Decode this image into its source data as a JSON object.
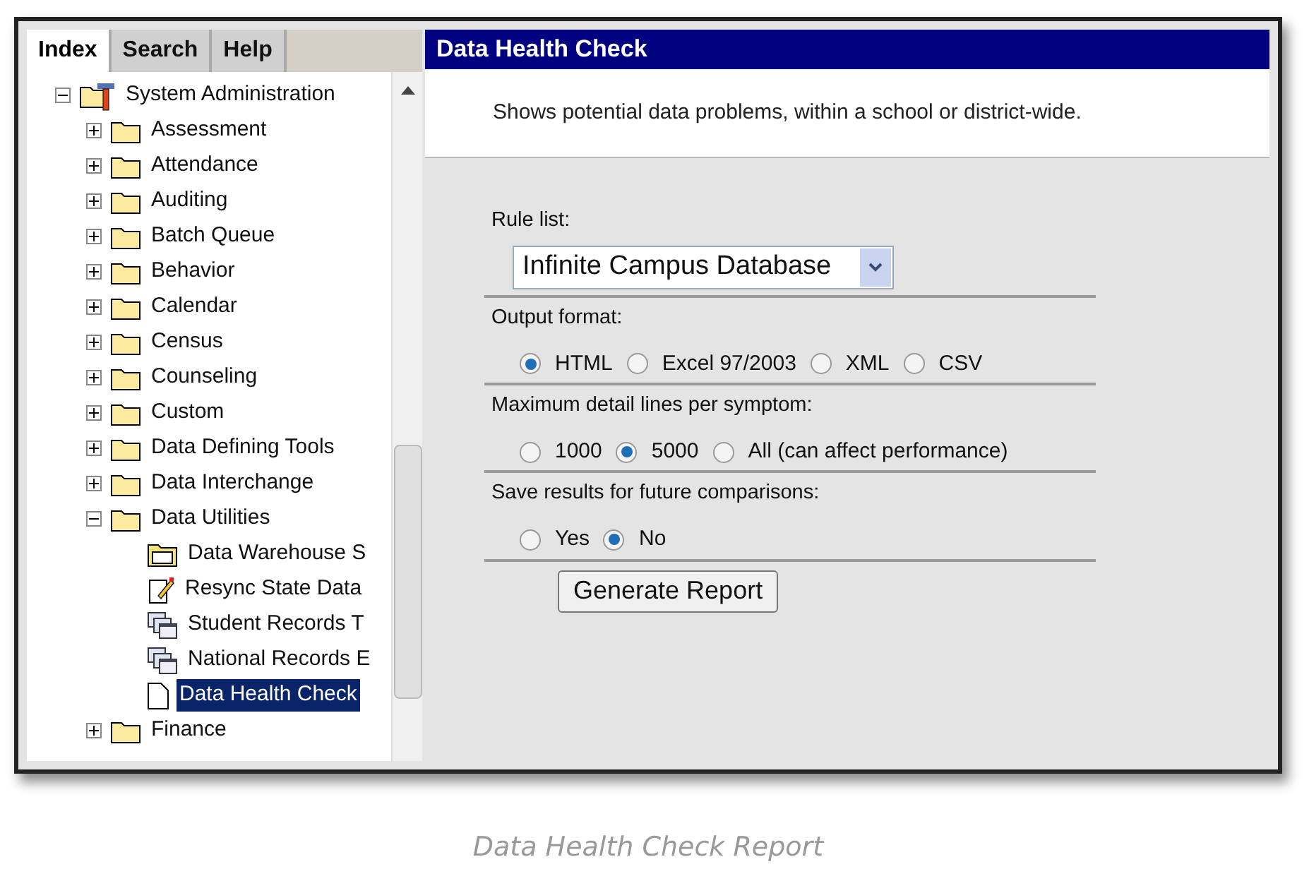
{
  "tabs": [
    {
      "label": "Index",
      "selected": true
    },
    {
      "label": "Search",
      "selected": false
    },
    {
      "label": "Help",
      "selected": false
    }
  ],
  "tree": [
    {
      "label": "System Administration",
      "kind": "tools",
      "expanded": true,
      "selected": false,
      "children": [
        {
          "label": "Assessment",
          "kind": "folder",
          "expanded": false,
          "selected": false
        },
        {
          "label": "Attendance",
          "kind": "folder",
          "expanded": false,
          "selected": false
        },
        {
          "label": "Auditing",
          "kind": "folder",
          "expanded": false,
          "selected": false
        },
        {
          "label": "Batch Queue",
          "kind": "folder",
          "expanded": false,
          "selected": false
        },
        {
          "label": "Behavior",
          "kind": "folder",
          "expanded": false,
          "selected": false
        },
        {
          "label": "Calendar",
          "kind": "folder",
          "expanded": false,
          "selected": false
        },
        {
          "label": "Census",
          "kind": "folder",
          "expanded": false,
          "selected": false
        },
        {
          "label": "Counseling",
          "kind": "folder",
          "expanded": false,
          "selected": false
        },
        {
          "label": "Custom",
          "kind": "folder",
          "expanded": false,
          "selected": false
        },
        {
          "label": "Data Defining Tools",
          "kind": "folder",
          "expanded": false,
          "selected": false
        },
        {
          "label": "Data Interchange",
          "kind": "folder",
          "expanded": false,
          "selected": false
        },
        {
          "label": "Data Utilities",
          "kind": "folder",
          "expanded": true,
          "selected": false,
          "children": [
            {
              "label": "Data Warehouse S",
              "kind": "open-folder",
              "selected": false
            },
            {
              "label": "Resync State Data",
              "kind": "note",
              "selected": false
            },
            {
              "label": "Student Records T",
              "kind": "pages",
              "selected": false
            },
            {
              "label": "National Records E",
              "kind": "pages",
              "selected": false
            },
            {
              "label": "Data Health Check",
              "kind": "document",
              "selected": true
            }
          ]
        },
        {
          "label": "Finance",
          "kind": "folder",
          "expanded": false,
          "selected": false
        }
      ]
    }
  ],
  "panel": {
    "title": "Data Health Check",
    "description": "Shows potential data problems, within a school or district-wide.",
    "rule_list": {
      "label": "Rule list:",
      "value": "Infinite Campus Database"
    },
    "groups": [
      {
        "label": "Output format:",
        "options": [
          {
            "label": "HTML",
            "selected": true
          },
          {
            "label": "Excel 97/2003",
            "selected": false
          },
          {
            "label": "XML",
            "selected": false
          },
          {
            "label": "CSV",
            "selected": false
          }
        ]
      },
      {
        "label": "Maximum detail lines per symptom:",
        "options": [
          {
            "label": "1000",
            "selected": false
          },
          {
            "label": "5000",
            "selected": true
          },
          {
            "label": "All (can affect performance)",
            "selected": false
          }
        ]
      },
      {
        "label": "Save results for future comparisons:",
        "options": [
          {
            "label": "Yes",
            "selected": false
          },
          {
            "label": "No",
            "selected": true
          }
        ]
      }
    ],
    "button": "Generate Report"
  },
  "caption": "Data Health Check Report"
}
